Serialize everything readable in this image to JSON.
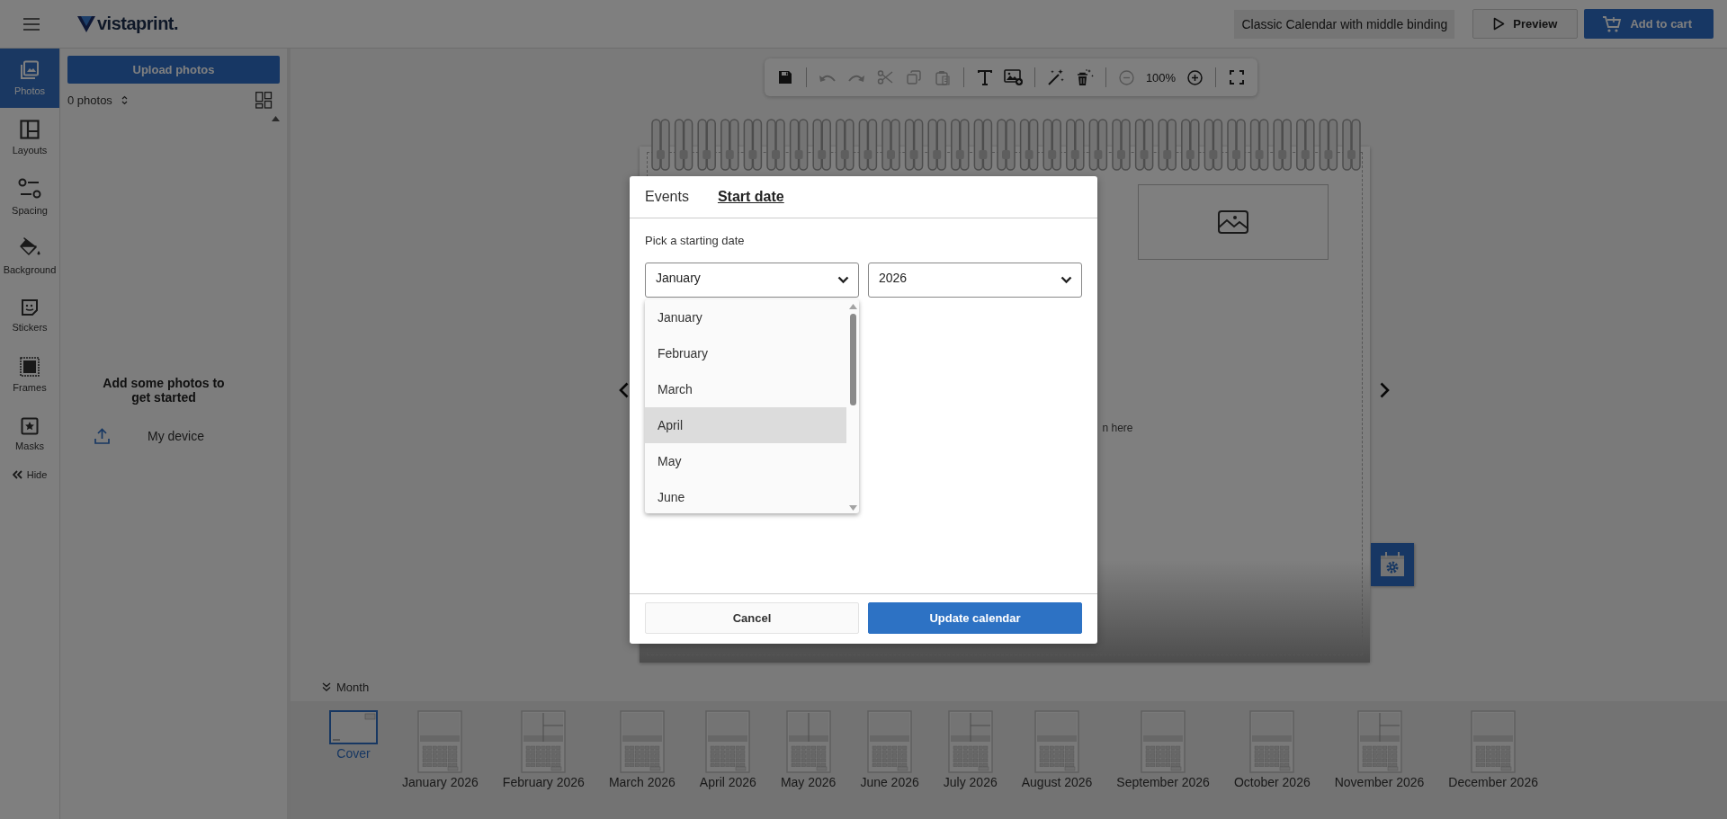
{
  "header": {
    "logo": "vistaprint.",
    "document_title": "Classic Calendar with middle binding",
    "buttons": [
      {
        "label": "Preview",
        "kind": "preview"
      },
      {
        "label": "Add to cart",
        "kind": "cart"
      }
    ]
  },
  "sidebar": {
    "items": [
      {
        "label": "Photos",
        "kind": "photos",
        "selected": true
      },
      {
        "label": "Layouts",
        "kind": "layouts",
        "selected": false
      },
      {
        "label": "Spacing",
        "kind": "spacing",
        "selected": false
      },
      {
        "label": "Background",
        "kind": "background",
        "selected": false
      },
      {
        "label": "Stickers",
        "kind": "stickers",
        "selected": false
      },
      {
        "label": "Frames",
        "kind": "frames",
        "selected": false
      },
      {
        "label": "Masks",
        "kind": "masks",
        "selected": false
      }
    ],
    "hide_label": "Hide"
  },
  "photos_panel": {
    "upload_button": "Upload photos",
    "count": "0 photos",
    "empty_message": "Add some photos to get started",
    "source": "My device"
  },
  "toolbar": {
    "groups": [
      {
        "tools": [
          {
            "kind": "save",
            "disabled": false
          }
        ]
      },
      {
        "tools": [
          {
            "kind": "undo",
            "disabled": true
          },
          {
            "kind": "redo",
            "disabled": true
          },
          {
            "kind": "cut",
            "disabled": true
          },
          {
            "kind": "copy",
            "disabled": true
          },
          {
            "kind": "paste",
            "disabled": true
          }
        ]
      },
      {
        "tools": [
          {
            "kind": "text",
            "disabled": false
          },
          {
            "kind": "add-image",
            "disabled": false
          }
        ]
      },
      {
        "tools": [
          {
            "kind": "magic",
            "disabled": false
          },
          {
            "kind": "clear",
            "disabled": false
          }
        ]
      },
      {
        "tools": [
          {
            "kind": "zoom-out",
            "disabled": true
          },
          {
            "kind": "zoom-level",
            "label": "100%",
            "disabled": false
          },
          {
            "kind": "zoom-in",
            "disabled": false
          }
        ]
      },
      {
        "tools": [
          {
            "kind": "fullscreen",
            "disabled": false
          }
        ]
      }
    ]
  },
  "canvas": {
    "drop_hint": "n here"
  },
  "dialog": {
    "tabs": [
      {
        "label": "Events",
        "selected": false
      },
      {
        "label": "Start date",
        "selected": true
      }
    ],
    "prompt": "Pick a starting date",
    "month_select": {
      "value": "January",
      "expanded": true,
      "options": [
        {
          "label": "January",
          "highlighted": false
        },
        {
          "label": "February",
          "highlighted": false
        },
        {
          "label": "March",
          "highlighted": false
        },
        {
          "label": "April",
          "highlighted": true
        },
        {
          "label": "May",
          "highlighted": false
        },
        {
          "label": "June",
          "highlighted": false
        }
      ]
    },
    "year_select": {
      "value": "2026"
    },
    "buttons": [
      {
        "label": "Cancel",
        "kind": "secondary"
      },
      {
        "label": "Update calendar",
        "kind": "primary"
      }
    ]
  },
  "page_strip": {
    "tab_label": "Month",
    "pages": [
      {
        "label": "Cover",
        "kind": "cover",
        "selected": true
      },
      {
        "label": "January 2026",
        "kind": "one-photo",
        "selected": false
      },
      {
        "label": "February 2026",
        "kind": "three-photo",
        "selected": false
      },
      {
        "label": "March 2026",
        "kind": "one-photo",
        "selected": false
      },
      {
        "label": "April 2026",
        "kind": "one-photo",
        "selected": false
      },
      {
        "label": "May 2026",
        "kind": "two-photo",
        "selected": false
      },
      {
        "label": "June 2026",
        "kind": "one-photo",
        "selected": false
      },
      {
        "label": "July 2026",
        "kind": "three-photo",
        "selected": false
      },
      {
        "label": "August 2026",
        "kind": "one-photo",
        "selected": false
      },
      {
        "label": "September 2026",
        "kind": "one-photo",
        "selected": false
      },
      {
        "label": "October 2026",
        "kind": "one-photo",
        "selected": false
      },
      {
        "label": "November 2026",
        "kind": "three-photo",
        "selected": false
      },
      {
        "label": "December 2026",
        "kind": "one-photo",
        "selected": false
      }
    ]
  }
}
